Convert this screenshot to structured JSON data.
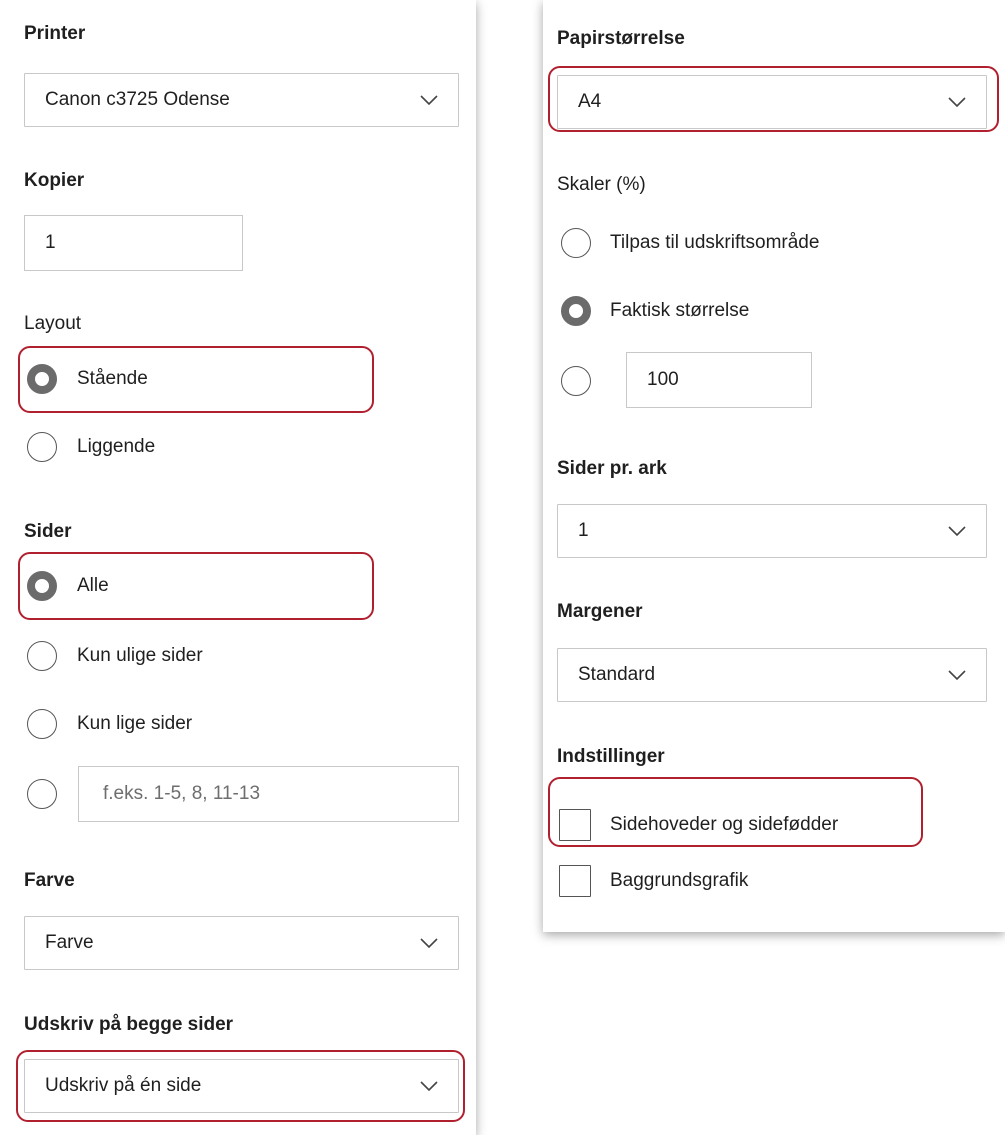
{
  "left": {
    "printer": {
      "heading": "Printer",
      "value": "Canon c3725 Odense"
    },
    "copies": {
      "heading": "Kopier",
      "value": "1"
    },
    "layout": {
      "heading": "Layout",
      "options": [
        {
          "label": "Stående",
          "checked": true
        },
        {
          "label": "Liggende",
          "checked": false
        }
      ]
    },
    "pages": {
      "heading": "Sider",
      "options": [
        {
          "label": "Alle",
          "checked": true
        },
        {
          "label": "Kun ulige sider",
          "checked": false
        },
        {
          "label": "Kun lige sider",
          "checked": false
        }
      ],
      "custom_placeholder": "f.eks. 1-5, 8, 11-13"
    },
    "color": {
      "heading": "Farve",
      "value": "Farve"
    },
    "duplex": {
      "heading": "Udskriv på begge sider",
      "value": "Udskriv på én side"
    }
  },
  "right": {
    "paper_size": {
      "heading": "Papirstørrelse",
      "value": "A4"
    },
    "scale": {
      "heading": "Skaler (%)",
      "options": [
        {
          "label": "Tilpas til udskriftsområde",
          "checked": false
        },
        {
          "label": "Faktisk størrelse",
          "checked": true
        }
      ],
      "custom_value": "100"
    },
    "pages_per_sheet": {
      "heading": "Sider pr. ark",
      "value": "1"
    },
    "margins": {
      "heading": "Margener",
      "value": "Standard"
    },
    "settings": {
      "heading": "Indstillinger",
      "options": [
        {
          "label": "Sidehoveder og sidefødder",
          "checked": false
        },
        {
          "label": "Baggrundsgrafik",
          "checked": false
        }
      ]
    }
  },
  "colors": {
    "highlight": "#b0202f",
    "radio_checked": "#6b6b6b",
    "border": "#c8c8c8"
  }
}
